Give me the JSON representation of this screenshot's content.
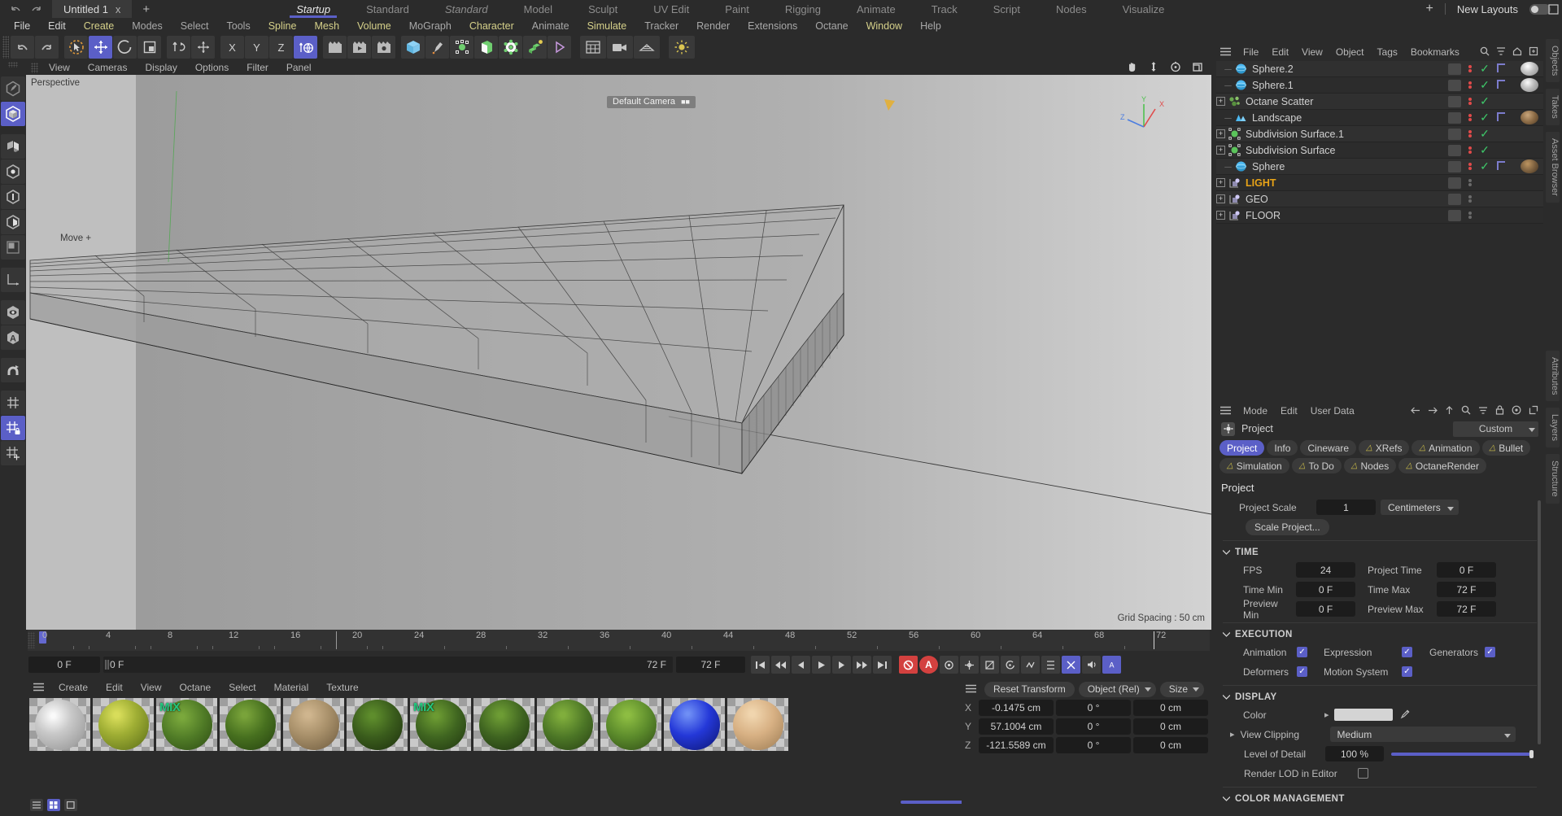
{
  "topbar": {
    "undo_icon": "undo-icon",
    "redo_icon": "redo-icon",
    "document_tab": "Untitled 1",
    "close_tab": "x",
    "add_tab": "+",
    "layout_tabs": [
      {
        "label": "Startup",
        "active": true
      },
      {
        "label": "Standard",
        "active": false
      },
      {
        "label": "Standard",
        "active": false,
        "italic": true
      },
      {
        "label": "Model",
        "active": false
      },
      {
        "label": "Sculpt",
        "active": false
      },
      {
        "label": "UV Edit",
        "active": false
      },
      {
        "label": "Paint",
        "active": false
      },
      {
        "label": "Rigging",
        "active": false
      },
      {
        "label": "Animate",
        "active": false
      },
      {
        "label": "Track",
        "active": false
      },
      {
        "label": "Script",
        "active": false
      },
      {
        "label": "Nodes",
        "active": false
      },
      {
        "label": "Visualize",
        "active": false
      }
    ],
    "plus": "+",
    "new_layouts_label": "New Layouts"
  },
  "menubar": [
    {
      "label": "File",
      "color": "#d4d4d4"
    },
    {
      "label": "Edit",
      "color": "#d4d4d4"
    },
    {
      "label": "Create",
      "color": "#d6d18a"
    },
    {
      "label": "Modes",
      "color": "#a8a8a8"
    },
    {
      "label": "Select",
      "color": "#a8a8a8"
    },
    {
      "label": "Tools",
      "color": "#a8a8a8"
    },
    {
      "label": "Spline",
      "color": "#d6d18a"
    },
    {
      "label": "Mesh",
      "color": "#d6d18a"
    },
    {
      "label": "Volume",
      "color": "#d6d18a"
    },
    {
      "label": "MoGraph",
      "color": "#a8a8a8"
    },
    {
      "label": "Character",
      "color": "#d6d18a"
    },
    {
      "label": "Animate",
      "color": "#a8a8a8"
    },
    {
      "label": "Simulate",
      "color": "#d6d18a"
    },
    {
      "label": "Tracker",
      "color": "#a8a8a8"
    },
    {
      "label": "Render",
      "color": "#a8a8a8"
    },
    {
      "label": "Extensions",
      "color": "#a8a8a8"
    },
    {
      "label": "Octane",
      "color": "#a8a8a8"
    },
    {
      "label": "Window",
      "color": "#d6d18a"
    },
    {
      "label": "Help",
      "color": "#a8a8a8"
    }
  ],
  "toolbar": {
    "groups": [
      {
        "buttons": [
          {
            "name": "undo-button",
            "icon": "undo-icon"
          },
          {
            "name": "redo-button",
            "icon": "redo-icon"
          }
        ]
      },
      {
        "buttons": [
          {
            "name": "live-selection-button",
            "icon": "live-selection-icon"
          },
          {
            "name": "move-tool-button",
            "icon": "move-icon",
            "active": true
          },
          {
            "name": "rotate-tool-button",
            "icon": "rotate-icon"
          },
          {
            "name": "scale-tool-button",
            "icon": "scale-icon"
          }
        ]
      },
      {
        "buttons": [
          {
            "name": "world-object-axis-button",
            "icon": "axis-toggle-icon"
          },
          {
            "name": "move-axis-button",
            "icon": "move-axis-icon"
          }
        ]
      },
      {
        "buttons": [
          {
            "name": "lock-x-button",
            "icon": "X"
          },
          {
            "name": "lock-y-button",
            "icon": "Y"
          },
          {
            "name": "lock-z-button",
            "icon": "Z"
          },
          {
            "name": "world-coordinates-button",
            "icon": "globe-icon",
            "active": true
          }
        ]
      },
      {
        "buttons": [
          {
            "name": "render-view-button",
            "icon": "render-view-icon"
          },
          {
            "name": "render-to-picture-viewer-button",
            "icon": "render-picture-icon"
          },
          {
            "name": "render-settings-button",
            "icon": "render-settings-icon"
          }
        ]
      },
      {
        "buttons": [
          {
            "name": "cube-primitive-button",
            "icon": "cube-icon"
          },
          {
            "name": "spline-pen-button",
            "icon": "pen-icon"
          },
          {
            "name": "null-object-button",
            "icon": "null-icon"
          },
          {
            "name": "extrude-generator-button",
            "icon": "extrude-icon"
          },
          {
            "name": "bend-deformer-button",
            "icon": "deformer-icon"
          },
          {
            "name": "mograph-cloner-button",
            "icon": "cloner-icon"
          },
          {
            "name": "light-button",
            "icon": "light-icon"
          }
        ]
      },
      {
        "buttons": [
          {
            "name": "content-browser-button",
            "icon": "content-browser-icon"
          },
          {
            "name": "camera-button",
            "icon": "camera-icon"
          },
          {
            "name": "floor-button",
            "icon": "floor-icon"
          }
        ]
      },
      {
        "buttons": [
          {
            "name": "octane-light-button",
            "icon": "sun-icon"
          }
        ]
      }
    ]
  },
  "left_toolbar": [
    {
      "name": "model-edit-mode-button",
      "icon": "pencil-hex-icon"
    },
    {
      "name": "object-mode-button",
      "icon": "cube-hex-icon",
      "active": true
    },
    {
      "name": "model-mode-button",
      "icon": "model-icon"
    },
    {
      "name": "point-mode-button",
      "icon": "point-icon"
    },
    {
      "name": "edge-mode-button",
      "icon": "edge-icon"
    },
    {
      "name": "polygon-mode-button",
      "icon": "polygon-icon"
    },
    {
      "name": "texture-mode-button",
      "icon": "texture-icon"
    },
    {
      "name": "workplane-button",
      "icon": "axis-icon"
    },
    {
      "name": "viewport-solo-button",
      "icon": "eye-icon"
    },
    {
      "name": "axis-anchor-button",
      "icon": "letter-a-icon"
    },
    {
      "name": "enable-snapping-button",
      "icon": "magnet-icon"
    },
    {
      "name": "workplane-grid-button",
      "icon": "grid-icon"
    },
    {
      "name": "workplane-lock-button",
      "icon": "grid-lock-icon",
      "active": true
    },
    {
      "name": "move-workplane-button",
      "icon": "move-plane-icon"
    }
  ],
  "viewport": {
    "menus": [
      "View",
      "Cameras",
      "Display",
      "Options",
      "Filter",
      "Panel"
    ],
    "perspective_label": "Perspective",
    "move_label": "Move",
    "default_camera_label": "Default Camera",
    "grid_spacing_label": "Grid Spacing : 50 cm",
    "axis": {
      "x": "X",
      "y": "Y",
      "z": "Z"
    },
    "icons": [
      "pan-icon",
      "zoom-icon",
      "orbit-icon",
      "maximize-icon"
    ]
  },
  "timeline": {
    "ticks": [
      0,
      4,
      8,
      12,
      16,
      20,
      24,
      28,
      32,
      36,
      40,
      44,
      48,
      52,
      56,
      60,
      64,
      68,
      72
    ],
    "current_frame_field": "0 F",
    "frame_display": "0 F",
    "end_field_left": "72 F",
    "end_field_right": "72 F",
    "range_end": "0 F",
    "playback_buttons": [
      {
        "name": "go-to-start-button",
        "icon": "skip-start-icon"
      },
      {
        "name": "previous-keyframe-button",
        "icon": "prev-key-icon"
      },
      {
        "name": "step-back-button",
        "icon": "step-back-icon"
      },
      {
        "name": "play-button",
        "icon": "play-icon"
      },
      {
        "name": "step-forward-button",
        "icon": "step-forward-icon"
      },
      {
        "name": "next-keyframe-button",
        "icon": "next-key-icon"
      },
      {
        "name": "go-to-end-button",
        "icon": "skip-end-icon"
      }
    ],
    "record_buttons": [
      {
        "name": "record-active-objects-button",
        "icon": "record-icon"
      },
      {
        "name": "autokeying-button",
        "icon": "autokey-icon"
      },
      {
        "name": "keyframe-selection-button",
        "icon": "key-select-icon"
      },
      {
        "name": "position-key-button",
        "icon": "position-key-icon"
      },
      {
        "name": "scale-key-button",
        "icon": "scale-key-icon"
      },
      {
        "name": "rotation-key-button",
        "icon": "rotation-key-icon"
      },
      {
        "name": "parameter-key-button",
        "icon": "param-key-icon"
      },
      {
        "name": "pla-key-button",
        "icon": "pla-key-icon"
      },
      {
        "name": "sound-button",
        "icon": "sound-icon"
      },
      {
        "name": "animation-mode-button",
        "icon": "anim-mode-icon"
      }
    ]
  },
  "material_manager": {
    "menus": [
      "Create",
      "Edit",
      "View",
      "Octane",
      "Select",
      "Material",
      "Texture"
    ],
    "materials": [
      {
        "name": "mat-1",
        "color": "#c3c3c3",
        "mix": false
      },
      {
        "name": "mat-2",
        "color": "#9aa832",
        "mix": false
      },
      {
        "name": "mat-3",
        "color": "#5d8a2c",
        "mix": true,
        "mix_label": "MIX"
      },
      {
        "name": "mat-4",
        "color": "#4f7a28",
        "mix": false
      },
      {
        "name": "mat-5",
        "color": "#a9916a",
        "mix": false
      },
      {
        "name": "mat-6",
        "color": "#3d5c1f",
        "mix": false
      },
      {
        "name": "mat-7",
        "color": "#44671f",
        "mix": true,
        "mix_label": "MIX"
      },
      {
        "name": "mat-8",
        "color": "#3f6422",
        "mix": false
      },
      {
        "name": "mat-9",
        "color": "#4d7528",
        "mix": false
      },
      {
        "name": "mat-10",
        "color": "#5c8a2b",
        "mix": false
      },
      {
        "name": "mat-11",
        "color": "#2438d8",
        "mix": false
      },
      {
        "name": "mat-12",
        "color": "#d8b184",
        "mix": false
      }
    ],
    "view_buttons": [
      "list-view-icon",
      "grid-view-icon",
      "large-icon-view-icon"
    ]
  },
  "coordinates": {
    "reset_transform_label": "Reset Transform",
    "space_dropdown": "Object (Rel)",
    "size_dropdown": "Size",
    "rows": [
      {
        "axis": "X",
        "position": "-0.1475 cm",
        "rotation": "0 °",
        "size": "0 cm"
      },
      {
        "axis": "Y",
        "position": "57.1004 cm",
        "rotation": "0 °",
        "size": "0 cm"
      },
      {
        "axis": "Z",
        "position": "-121.5589 cm",
        "rotation": "0 °",
        "size": "0 cm"
      }
    ]
  },
  "object_manager": {
    "menus": [
      "File",
      "Edit",
      "View",
      "Object",
      "Tags",
      "Bookmarks"
    ],
    "icons": [
      "search-icon",
      "filter-icon",
      "home-icon",
      "expand-icon"
    ],
    "objects": [
      {
        "label": "Sphere.2",
        "icon": "sphere-icon",
        "icon_color": "#4db8f0",
        "expandable": false,
        "visible_dots": true,
        "check": true,
        "has_tag": true,
        "has_material": true,
        "mat_color": "#c0c0c0"
      },
      {
        "label": "Sphere.1",
        "icon": "sphere-icon",
        "icon_color": "#4db8f0",
        "expandable": false,
        "visible_dots": true,
        "check": true,
        "has_tag": true,
        "has_material": true,
        "mat_color": "#bcbcbc"
      },
      {
        "label": "Octane Scatter",
        "icon": "scatter-icon",
        "icon_color": "#6aa84f",
        "expandable": true,
        "visible_dots": true,
        "check": true,
        "has_tag": false,
        "has_material": false,
        "mat_color": ""
      },
      {
        "label": "Landscape",
        "icon": "landscape-icon",
        "icon_color": "#4db8f0",
        "expandable": false,
        "visible_dots": true,
        "check": true,
        "has_tag": true,
        "has_material": true,
        "mat_color": "#8a6a45"
      },
      {
        "label": "Subdivision Surface.1",
        "icon": "subdiv-icon",
        "icon_color": "#5bc45b",
        "expandable": true,
        "visible_dots": true,
        "check": true,
        "has_tag": false,
        "has_material": false,
        "mat_color": ""
      },
      {
        "label": "Subdivision Surface",
        "icon": "subdiv-icon",
        "icon_color": "#5bc45b",
        "expandable": true,
        "visible_dots": true,
        "check": true,
        "has_tag": false,
        "has_material": false,
        "mat_color": ""
      },
      {
        "label": "Sphere",
        "icon": "sphere-icon",
        "icon_color": "#4db8f0",
        "expandable": false,
        "visible_dots": true,
        "check": true,
        "has_tag": true,
        "has_material": true,
        "mat_color": "#7d6140"
      },
      {
        "label": "LIGHT",
        "icon": "null-icon",
        "icon_color": "#b9b3e8",
        "expandable": true,
        "visible_dots": false,
        "check": false,
        "has_tag": false,
        "has_material": false,
        "highlight": true
      },
      {
        "label": "GEO",
        "icon": "null-icon",
        "icon_color": "#b9b3e8",
        "expandable": true,
        "visible_dots": false,
        "check": false,
        "has_tag": false,
        "has_material": false
      },
      {
        "label": "FLOOR",
        "icon": "null-icon",
        "icon_color": "#b9b3e8",
        "expandable": true,
        "visible_dots": false,
        "check": false,
        "has_tag": false,
        "has_material": false
      }
    ]
  },
  "attributes": {
    "menus": [
      "Mode",
      "Edit",
      "User Data"
    ],
    "icons": [
      "back-icon",
      "forward-icon",
      "up-icon",
      "search-icon",
      "filter-icon",
      "lock-icon",
      "pin-icon",
      "popout-icon"
    ],
    "object_name": "Project",
    "preset_dropdown": "Custom",
    "tabs": [
      {
        "label": "Project",
        "active": true,
        "bell": false
      },
      {
        "label": "Info",
        "active": false,
        "bell": false
      },
      {
        "label": "Cineware",
        "active": false,
        "bell": false
      },
      {
        "label": "XRefs",
        "active": false,
        "bell": true
      },
      {
        "label": "Animation",
        "active": false,
        "bell": true
      },
      {
        "label": "Bullet",
        "active": false,
        "bell": true
      },
      {
        "label": "Simulation",
        "active": false,
        "bell": true
      },
      {
        "label": "To Do",
        "active": false,
        "bell": true
      },
      {
        "label": "Nodes",
        "active": false,
        "bell": true
      },
      {
        "label": "OctaneRender",
        "active": false,
        "bell": true
      }
    ],
    "section_title": "Project",
    "project_scale_label": "Project Scale",
    "project_scale_value": "1",
    "project_units": "Centimeters",
    "scale_project_button": "Scale Project...",
    "time_section": "TIME",
    "fps_label": "FPS",
    "fps_value": "24",
    "project_time_label": "Project Time",
    "project_time_value": "0 F",
    "time_min_label": "Time Min",
    "time_min_value": "0 F",
    "time_max_label": "Time Max",
    "time_max_value": "72 F",
    "preview_min_label": "Preview Min",
    "preview_min_value": "0 F",
    "preview_max_label": "Preview Max",
    "preview_max_value": "72 F",
    "execution_section": "EXECUTION",
    "animation_label": "Animation",
    "expression_label": "Expression",
    "generators_label": "Generators",
    "deformers_label": "Deformers",
    "motion_system_label": "Motion System",
    "display_section": "DISPLAY",
    "color_label": "Color",
    "color_value": "#d4d4d4",
    "view_clipping_label": "View Clipping",
    "view_clipping_value": "Medium",
    "level_of_detail_label": "Level of Detail",
    "level_of_detail_value": "100 %",
    "render_lod_label": "Render LOD in Editor",
    "color_management_section": "COLOR MANAGEMENT"
  },
  "vertical_tabs": [
    "Objects",
    "Takes",
    "Asset Browser",
    "Attributes",
    "Layers",
    "Structure"
  ]
}
